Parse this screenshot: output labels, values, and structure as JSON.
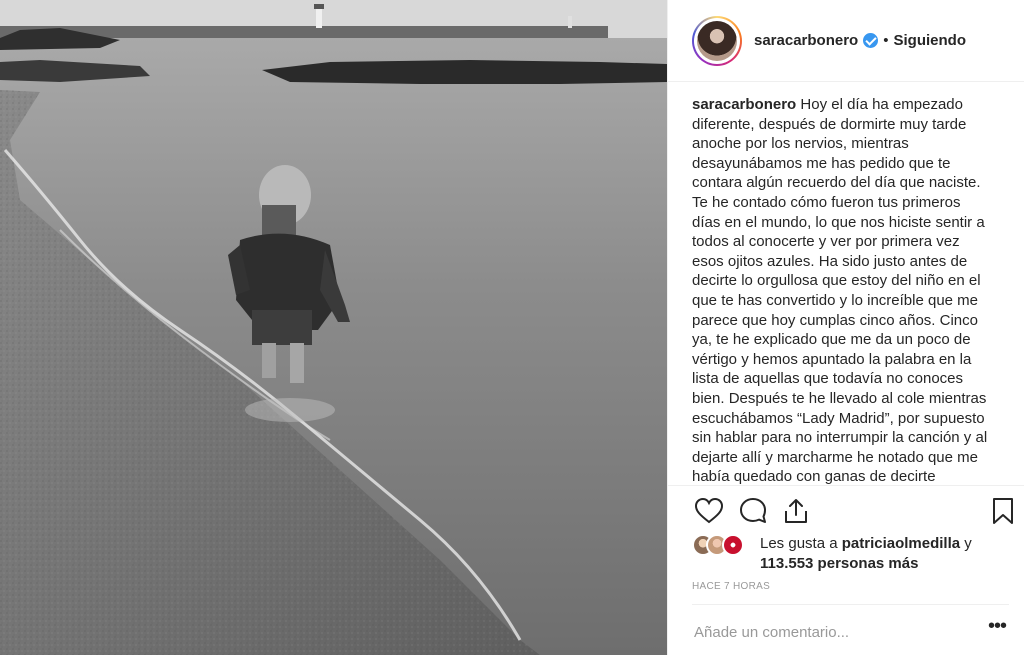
{
  "post": {
    "username": "saracarbonero",
    "separator": "•",
    "follow_status": "Siguiendo",
    "caption_text": "Hoy el día ha empezado diferente, después de dormirte muy tarde anoche por los nervios, mientras desayunábamos me has pedido que te contara algún recuerdo del día que naciste. Te he contado cómo fueron tus primeros días en el mundo, lo que nos hiciste sentir a todos al conocerte y ver por primera vez esos ojitos azules. Ha sido justo antes de decirte lo orgullosa que estoy del niño en el que te has convertido y lo increíble que me parece que hoy cumplas cinco años. Cinco ya, te he explicado que me da un poco de vértigo y hemos apuntado la palabra en la lista de aquellas que todavía no conoces bien. Después te he llevado al cole mientras escuchábamos “Lady Madrid”, por supuesto sin hablar para no interrumpir la canción y al dejarte allí y marcharme he notado que me había quedado con ganas de decirte",
    "likes_prefix": "Les gusta a",
    "likes_user": "patriciaolmedilla",
    "likes_conj": "y",
    "likes_count": "113.553 personas más",
    "timestamp": "HACE 7 HORAS"
  },
  "comment": {
    "placeholder": "Añade un comentario...",
    "more_label": "•••"
  },
  "icons": {
    "like": "heart-icon",
    "comment": "comment-bubble-icon",
    "share": "share-icon",
    "save": "bookmark-icon",
    "verified": "verified-badge-icon"
  },
  "colors": {
    "verified": "#3897f0",
    "text": "#262626",
    "muted": "#999999"
  }
}
